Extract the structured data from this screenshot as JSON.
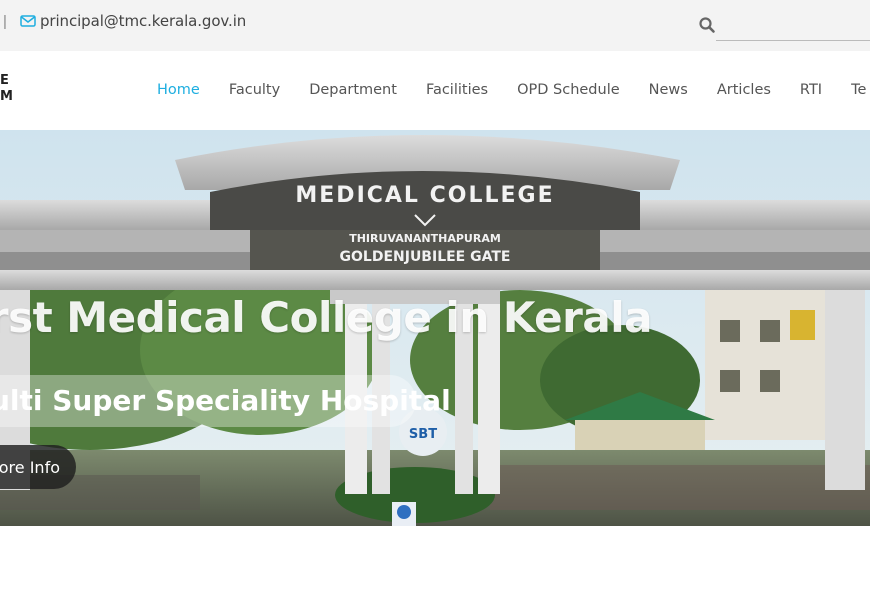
{
  "topbar": {
    "separator": "|",
    "email": "principal@tmc.kerala.gov.in",
    "search_placeholder": ""
  },
  "logo": {
    "line1": "E",
    "line2": "M"
  },
  "nav": {
    "items": [
      "Home",
      "Faculty",
      "Department",
      "Facilities",
      "OPD Schedule",
      "News",
      "Articles",
      "RTI",
      "Te"
    ]
  },
  "hero": {
    "title": "irst Medical College in Kerala",
    "subtitle": "ulti Super Speciality Hospital",
    "button": "ore Info",
    "gate_line1": "MEDICAL COLLEGE",
    "gate_line2": "THIRUVANANTHAPURAM",
    "gate_line3": "GOLDENJUBILEE GATE",
    "sign_text": "SBT"
  },
  "colors": {
    "accent": "#1eaee0",
    "topbar_bg": "#f3f3f3",
    "nav_text": "#555555"
  }
}
